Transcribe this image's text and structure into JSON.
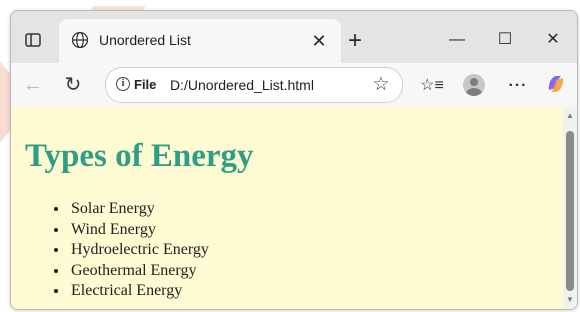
{
  "browser": {
    "tab": {
      "title": "Unordered List",
      "close_glyph": "✕",
      "icon": "globe-icon"
    },
    "new_tab_glyph": "+",
    "window_controls": {
      "minimize": "—",
      "maximize": "☐",
      "close": "✕"
    },
    "toolbar": {
      "back_glyph": "←",
      "reload_glyph": "↻",
      "address": {
        "info_glyph": "i",
        "scheme_label": "File",
        "url": "D:/Unordered_List.html"
      },
      "star_glyph": "☆",
      "favorites_glyph": "☆≡",
      "more_glyph": "···"
    },
    "colors": {
      "page_background": "#fefad1",
      "heading": "#2e9e84"
    }
  },
  "page": {
    "heading": "Types of Energy",
    "items": [
      "Solar Energy",
      "Wind Energy",
      "Hydroelectric Energy",
      "Geothermal Energy",
      "Electrical Energy"
    ]
  },
  "scrollbar": {
    "up_glyph": "▲",
    "down_glyph": "▼"
  }
}
